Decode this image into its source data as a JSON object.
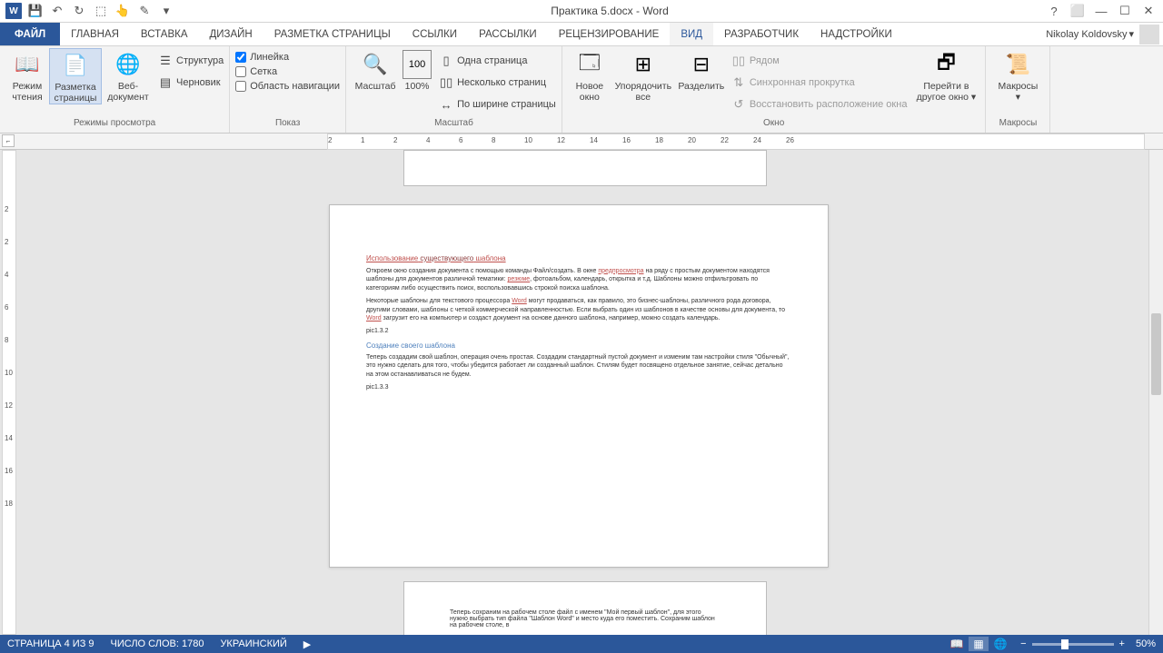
{
  "titlebar": {
    "title": "Практика 5.docx - Word"
  },
  "tabs": {
    "file": "ФАЙЛ",
    "items": [
      "ГЛАВНАЯ",
      "ВСТАВКА",
      "ДИЗАЙН",
      "РАЗМЕТКА СТРАНИЦЫ",
      "ССЫЛКИ",
      "РАССЫЛКИ",
      "РЕЦЕНЗИРОВАНИЕ",
      "ВИД",
      "РАЗРАБОТЧИК",
      "НАДСТРОЙКИ"
    ],
    "active": "ВИД",
    "user": "Nikolay Koldovsky"
  },
  "ribbon": {
    "views": {
      "label": "Режимы просмотра",
      "read": "Режим\nчтения",
      "print": "Разметка\nстраницы",
      "web": "Веб-\nдокумент",
      "outline": "Структура",
      "draft": "Черновик"
    },
    "show": {
      "label": "Показ",
      "ruler": "Линейка",
      "grid": "Сетка",
      "nav": "Область навигации"
    },
    "zoom": {
      "label": "Масштаб",
      "zoom": "Масштаб",
      "hundred": "100%",
      "one": "Одна страница",
      "multi": "Несколько страниц",
      "width": "По ширине страницы"
    },
    "window": {
      "label": "Окно",
      "new": "Новое\nокно",
      "arrange": "Упорядочить\nвсе",
      "split": "Разделить",
      "side": "Рядом",
      "sync": "Синхронная прокрутка",
      "reset": "Восстановить расположение окна",
      "switch": "Перейти в\nдругое окно"
    },
    "macros": {
      "label": "Макросы",
      "btn": "Макросы"
    }
  },
  "ruler": {
    "ticks": [
      "2",
      "1",
      "2",
      "4",
      "6",
      "8",
      "10",
      "12",
      "14",
      "16",
      "18",
      "20",
      "22",
      "24",
      "26"
    ]
  },
  "vruler": {
    "ticks": [
      "2",
      "2",
      "4",
      "6",
      "8",
      "10",
      "12",
      "14",
      "16",
      "18"
    ]
  },
  "doc": {
    "h1a": "Использование",
    "h1b": "существующего",
    "h1c": "шаблона",
    "p1": "Откроем окно создания документа с помощью команды Файл/создать. В окне ",
    "p1r": "предпросмотра",
    "p1b": " на ряду с простым документом находятся шаблоны для документов различной тематики: ",
    "p1r2": "резюме",
    "p1c": ", фотоальбом, календарь, открытка и т.д. Шаблоны можно отфильтровать по категориям либо осуществить поиск, воспользовавшись строкой поиска шаблона.",
    "p2a": "Некоторые шаблоны для текстового процессора ",
    "p2w": "Word",
    "p2b": " могут продаваться, как правило, это бизнес-шаблоны, различного рода договора, другими словами, шаблоны с четкой коммерческой направленностью. Если выбрать один из шаблонов в качестве основы для документа, то ",
    "p2w2": "Word",
    "p2c": " загрузит его на компьютер и создаст документ на основе данного шаблона, например, можно создать календарь.",
    "pic1": "pic1.3.2",
    "h2": "Создание своего шаблона",
    "p3": "Теперь создадим свой шаблон, операция очень простая. Создадим стандартный пустой документ и изменим там настройки стиля \"Обычный\", это нужно сделать для того, чтобы убедится работает ли созданный шаблон. Стилям будет посвящено отдельное занятие, сейчас детально на этом останавливаться не будем.",
    "pic2": "pic1.3.3",
    "next": "Теперь сохраним на рабочем столе файл с именем \"Мой первый шаблон\", для этого нужно выбрать тип файла \"Шаблон Word\" и место куда его поместить. Сохраним шаблон на рабочем столе, в"
  },
  "status": {
    "page": "СТРАНИЦА 4 ИЗ 9",
    "words": "ЧИСЛО СЛОВ: 1780",
    "lang": "УКРАИНСКИЙ",
    "zoom": "50%"
  }
}
